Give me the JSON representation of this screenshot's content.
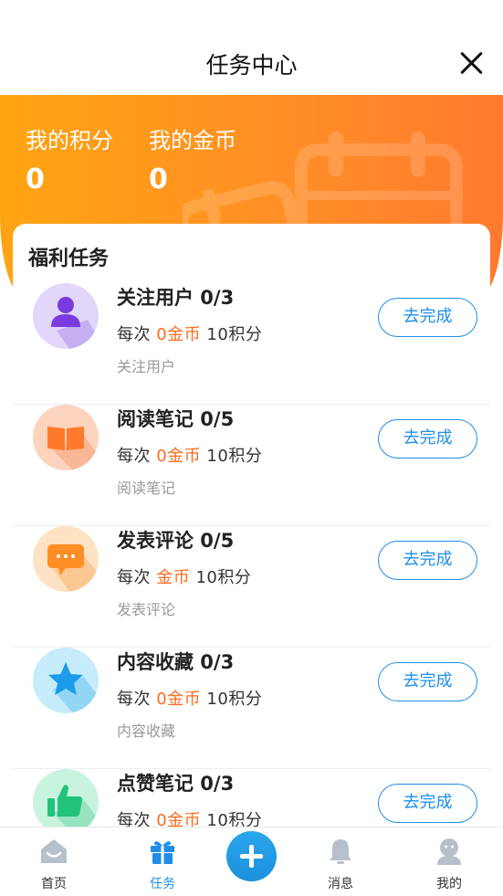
{
  "header": {
    "title": "任务中心"
  },
  "stats": {
    "points_label": "我的积分",
    "points_value": "0",
    "coins_label": "我的金币",
    "coins_value": "0"
  },
  "section_title": "福利任务",
  "tasks": [
    {
      "name": "关注用户 0/3",
      "prefix": "每次 ",
      "coin": "0金币",
      "suffix": " 10积分",
      "desc": "关注用户",
      "button": "去完成",
      "icon": "user-icon"
    },
    {
      "name": "阅读笔记 0/5",
      "prefix": "每次 ",
      "coin": "0金币",
      "suffix": " 10积分",
      "desc": "阅读笔记",
      "button": "去完成",
      "icon": "book-icon"
    },
    {
      "name": "发表评论 0/5",
      "prefix": "每次 ",
      "coin": "金币",
      "suffix": " 10积分",
      "desc": "发表评论",
      "button": "去完成",
      "icon": "comment-icon"
    },
    {
      "name": "内容收藏 0/3",
      "prefix": "每次 ",
      "coin": "0金币",
      "suffix": " 10积分",
      "desc": "内容收藏",
      "button": "去完成",
      "icon": "star-icon"
    },
    {
      "name": "点赞笔记 0/3",
      "prefix": "每次 ",
      "coin": "0金币",
      "suffix": " 10积分",
      "desc": "",
      "button": "去完成",
      "icon": "thumbs-up-icon"
    }
  ],
  "tabbar": {
    "items": [
      {
        "label": "首页",
        "icon": "home-icon"
      },
      {
        "label": "任务",
        "icon": "gift-icon",
        "active": true
      },
      {
        "label": "消息",
        "icon": "bell-icon"
      },
      {
        "label": "我的",
        "icon": "profile-icon"
      }
    ],
    "center_icon": "plus-icon"
  },
  "colors": {
    "accent": "#1f8ee9",
    "banner_start": "#ffa411",
    "banner_end": "#ff7a2e",
    "coin": "#ff6a1c"
  }
}
